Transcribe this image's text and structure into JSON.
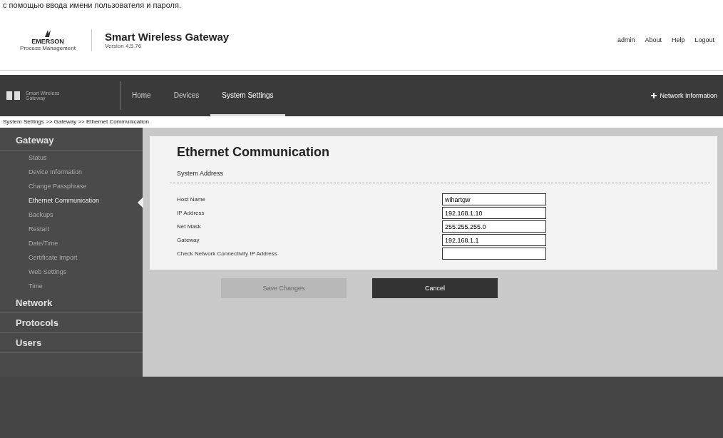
{
  "caption": "с помощью ввода имени пользователя и пароля.",
  "header": {
    "logo": "EMERSON",
    "logo_sub": "Process Management",
    "title": "Smart Wireless Gateway",
    "version": "Version 4.5.76",
    "links": [
      "admin",
      "About",
      "Help",
      "Logout"
    ]
  },
  "nav": {
    "brand": "Smart Wireless",
    "brand_sub": "Gateway",
    "tabs": [
      {
        "label": "Home",
        "selected": false
      },
      {
        "label": "Devices",
        "selected": false
      },
      {
        "label": "System Settings",
        "selected": true
      }
    ],
    "action": "Network Information"
  },
  "breadcrumb": "System Settings >> Gateway >> Ethernet Communication",
  "sidebar": {
    "sections": [
      {
        "label": "Gateway",
        "children": [
          {
            "label": "Status",
            "selected": false
          },
          {
            "label": "Device Information",
            "selected": false
          },
          {
            "label": "Change Passphrase",
            "selected": false
          },
          {
            "label": "Ethernet Communication",
            "selected": true
          },
          {
            "label": "Backups",
            "selected": false
          },
          {
            "label": "Restart",
            "selected": false
          },
          {
            "label": "Date/Time",
            "selected": false
          },
          {
            "label": "Certificate Import",
            "selected": false
          },
          {
            "label": "Web Settings",
            "selected": false
          },
          {
            "label": "Time",
            "selected": false
          }
        ]
      },
      {
        "label": "Network"
      },
      {
        "label": "Protocols"
      },
      {
        "label": "Users"
      }
    ]
  },
  "panel": {
    "title": "Ethernet Communication",
    "section": "System Address",
    "fields": [
      {
        "label": "Host Name",
        "value": "wihartgw"
      },
      {
        "label": "IP Address",
        "value": "192.168.1.10"
      },
      {
        "label": "Net Mask",
        "value": "255.255.255.0"
      },
      {
        "label": "Gateway",
        "value": "192.168.1.1"
      },
      {
        "label": "Check Network Connectivity IP Address"
      }
    ]
  },
  "buttons": [
    {
      "label": "Save Changes",
      "disabled": true
    },
    {
      "label": "Cancel",
      "disabled": false
    }
  ]
}
